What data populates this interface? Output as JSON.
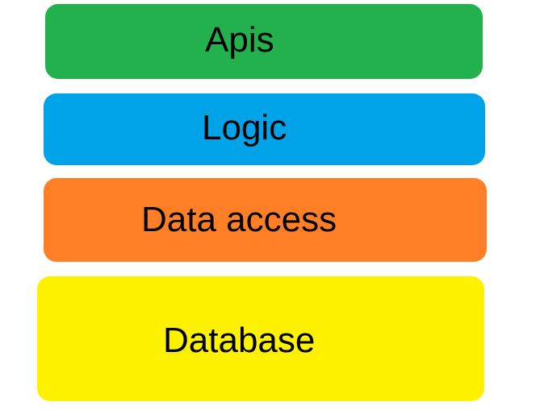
{
  "layers": [
    {
      "label": "Apis",
      "color": "#22b14c"
    },
    {
      "label": "Logic",
      "color": "#00a2e8"
    },
    {
      "label": "Data access",
      "color": "#ff7f27"
    },
    {
      "label": "Database",
      "color": "#fff200"
    }
  ]
}
